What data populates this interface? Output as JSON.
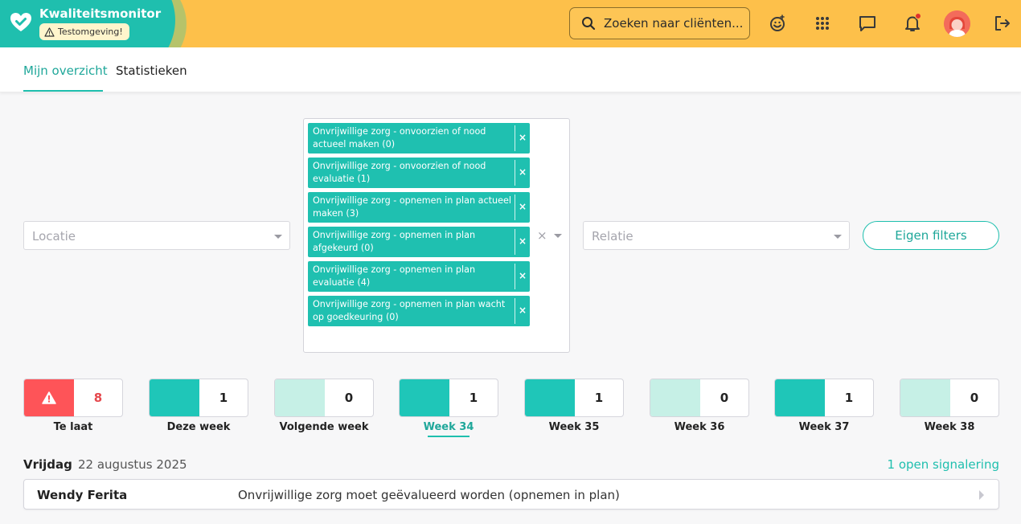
{
  "header": {
    "app_title": "Kwaliteitsmonitor",
    "env_badge": "Testomgeving!",
    "search_placeholder": "Zoeken naar cliënten...",
    "notification_dot_color": "#e0312d",
    "brand_color": "#1fbfae",
    "header_color": "#fdc04a"
  },
  "tabs": [
    {
      "label": "Mijn overzicht",
      "active": true
    },
    {
      "label": "Statistieken",
      "active": false
    }
  ],
  "filters": {
    "location_placeholder": "Locatie",
    "relation_placeholder": "Relatie",
    "clear_symbol": "×",
    "selected": [
      {
        "label": "Onvrijwillige zorg - onvoorzien of nood actueel maken (0)"
      },
      {
        "label": "Onvrijwillige zorg - onvoorzien of nood evaluatie (1)"
      },
      {
        "label": "Onvrijwillige zorg - opnemen in plan actueel maken (3)"
      },
      {
        "label": "Onvrijwillige zorg - opnemen in plan afgekeurd (0)"
      },
      {
        "label": "Onvrijwillige zorg - opnemen in plan evaluatie (4)"
      },
      {
        "label": "Onvrijwillige zorg - opnemen in plan wacht op goedkeuring (0)"
      }
    ],
    "chip_remove": "×",
    "own_filters_button": "Eigen filters"
  },
  "weeks": [
    {
      "label": "Te laat",
      "count": "8",
      "style": "late"
    },
    {
      "label": "Deze week",
      "count": "1",
      "style": "full"
    },
    {
      "label": "Volgende week",
      "count": "0",
      "style": "light"
    },
    {
      "label": "Week 34",
      "count": "1",
      "style": "full",
      "active": true
    },
    {
      "label": "Week 35",
      "count": "1",
      "style": "full"
    },
    {
      "label": "Week 36",
      "count": "0",
      "style": "light"
    },
    {
      "label": "Week 37",
      "count": "1",
      "style": "full"
    },
    {
      "label": "Week 38",
      "count": "0",
      "style": "light"
    }
  ],
  "colors": {
    "late_bg": "#fe5458",
    "late_count": "#e5484d",
    "full_bg": "#1fc6b8",
    "light_bg": "#c6f0e6"
  },
  "day": {
    "name": "Vrijdag",
    "date": "22 augustus 2025",
    "open_count": "1 open signalering",
    "rows": [
      {
        "client": "Wendy Ferita",
        "message": "Onvrijwillige zorg moet geëvalueerd worden (opnemen in plan)"
      }
    ]
  }
}
